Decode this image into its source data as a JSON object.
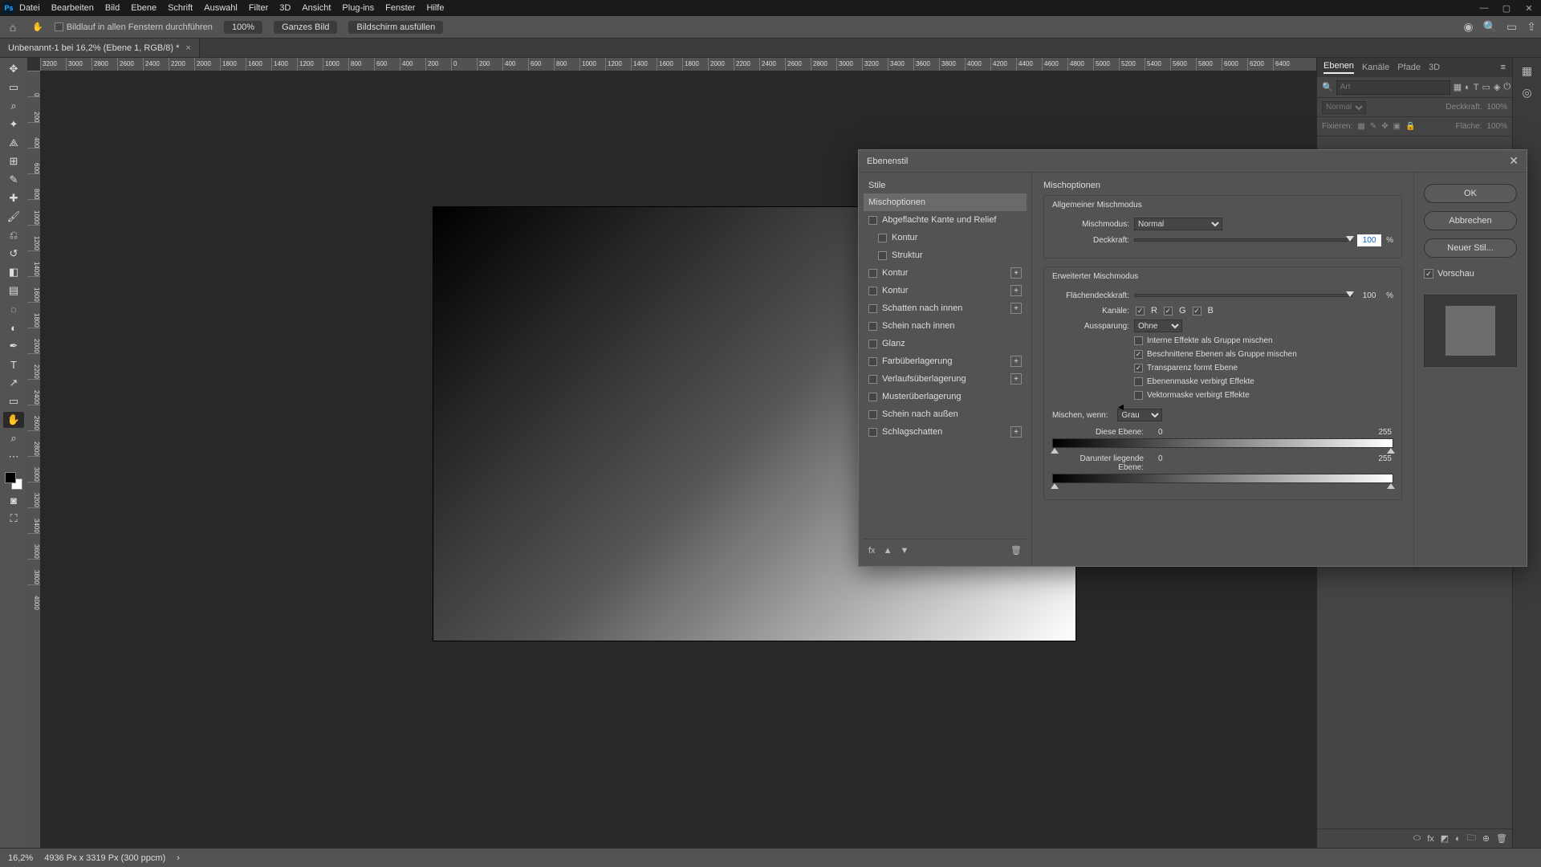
{
  "menu": [
    "Datei",
    "Bearbeiten",
    "Bild",
    "Ebene",
    "Schrift",
    "Auswahl",
    "Filter",
    "3D",
    "Ansicht",
    "Plug-ins",
    "Fenster",
    "Hilfe"
  ],
  "options": {
    "scroll_all_label": "Bildlauf in allen Fenstern durchführen",
    "zoom": "100%",
    "fit_btn": "Ganzes Bild",
    "fill_btn": "Bildschirm ausfüllen"
  },
  "doc": {
    "tab": "Unbenannt-1 bei 16,2% (Ebene 1, RGB/8) *"
  },
  "ruler": [
    "3200",
    "3000",
    "2800",
    "2600",
    "2400",
    "2200",
    "2000",
    "1800",
    "1600",
    "1400",
    "1200",
    "1000",
    "800",
    "600",
    "400",
    "200",
    "0",
    "200",
    "400",
    "600",
    "800",
    "1000",
    "1200",
    "1400",
    "1600",
    "1800",
    "2000",
    "2200",
    "2400",
    "2600",
    "2800",
    "3000",
    "3200",
    "3400",
    "3600",
    "3800",
    "4000",
    "4200",
    "4400",
    "4600",
    "4800",
    "5000",
    "5200",
    "5400",
    "5600",
    "5800",
    "6000",
    "6200",
    "6400"
  ],
  "ruler_v": [
    "0",
    "200",
    "400",
    "600",
    "800",
    "1000",
    "1200",
    "1400",
    "1600",
    "1800",
    "2000",
    "2200",
    "2400",
    "2600",
    "2800",
    "3000",
    "3200",
    "3400",
    "3600",
    "3800",
    "4000"
  ],
  "panels": {
    "tabs": [
      "Ebenen",
      "Kanäle",
      "Pfade",
      "3D"
    ],
    "search_placeholder": "Art",
    "mode": "Normal",
    "opacity_label": "Deckkraft:",
    "opacity_val": "100%",
    "lock_label": "Fixieren:",
    "fill_label": "Fläche:",
    "fill_val": "100%"
  },
  "status": {
    "zoom": "16,2%",
    "info": "4936 Px x 3319 Px (300 ppcm)"
  },
  "dialog": {
    "title": "Ebenenstil",
    "styles_header": "Stile",
    "styles": [
      {
        "label": "Mischoptionen",
        "checkbox": false,
        "selected": true,
        "indent": 0,
        "plus": false
      },
      {
        "label": "Abgeflachte Kante und Relief",
        "checkbox": true,
        "selected": false,
        "indent": 0,
        "plus": false
      },
      {
        "label": "Kontur",
        "checkbox": true,
        "selected": false,
        "indent": 1,
        "plus": false
      },
      {
        "label": "Struktur",
        "checkbox": true,
        "selected": false,
        "indent": 1,
        "plus": false
      },
      {
        "label": "Kontur",
        "checkbox": true,
        "selected": false,
        "indent": 0,
        "plus": true
      },
      {
        "label": "Kontur",
        "checkbox": true,
        "selected": false,
        "indent": 0,
        "plus": true
      },
      {
        "label": "Schatten nach innen",
        "checkbox": true,
        "selected": false,
        "indent": 0,
        "plus": true
      },
      {
        "label": "Schein nach innen",
        "checkbox": true,
        "selected": false,
        "indent": 0,
        "plus": false
      },
      {
        "label": "Glanz",
        "checkbox": true,
        "selected": false,
        "indent": 0,
        "plus": false
      },
      {
        "label": "Farbüberlagerung",
        "checkbox": true,
        "selected": false,
        "indent": 0,
        "plus": true
      },
      {
        "label": "Verlaufsüberlagerung",
        "checkbox": true,
        "selected": false,
        "indent": 0,
        "plus": true
      },
      {
        "label": "Musterüberlagerung",
        "checkbox": true,
        "selected": false,
        "indent": 0,
        "plus": false
      },
      {
        "label": "Schein nach außen",
        "checkbox": true,
        "selected": false,
        "indent": 0,
        "plus": false
      },
      {
        "label": "Schlagschatten",
        "checkbox": true,
        "selected": false,
        "indent": 0,
        "plus": true
      }
    ],
    "opts": {
      "title": "Mischoptionen",
      "group1_title": "Allgemeiner Mischmodus",
      "mode_label": "Mischmodus:",
      "mode_value": "Normal",
      "opacity_label": "Deckkraft:",
      "opacity_value": "100",
      "pct": "%",
      "group2_title": "Erweiterter Mischmodus",
      "fill_label": "Flächendeckkraft:",
      "fill_value": "100",
      "channels_label": "Kanäle:",
      "ch_r": "R",
      "ch_g": "G",
      "ch_b": "B",
      "knockout_label": "Aussparung:",
      "knockout_value": "Ohne",
      "cb1": "Interne Effekte als Gruppe mischen",
      "cb2": "Beschnittene Ebenen als Gruppe mischen",
      "cb3": "Transparenz formt Ebene",
      "cb4": "Ebenenmaske verbirgt Effekte",
      "cb5": "Vektormaske verbirgt Effekte",
      "blendif_label": "Mischen, wenn:",
      "blendif_value": "Grau",
      "this_label": "Diese Ebene:",
      "under_label": "Darunter liegende Ebene:",
      "v0": "0",
      "v255": "255"
    },
    "buttons": {
      "ok": "OK",
      "cancel": "Abbrechen",
      "new": "Neuer Stil...",
      "preview": "Vorschau"
    }
  }
}
